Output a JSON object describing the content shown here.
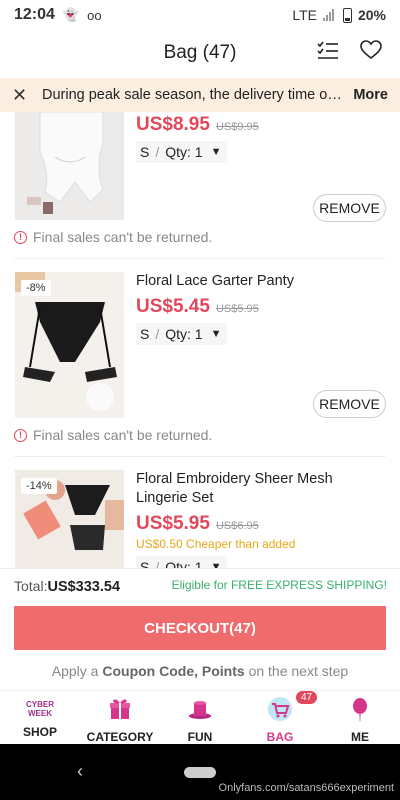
{
  "status": {
    "time": "12:04",
    "network": "LTE",
    "battery": "20%"
  },
  "header": {
    "title": "Bag (47)",
    "list_icon": "list-check-icon",
    "wish_icon": "heart-icon"
  },
  "notice": {
    "text": "During peak sale season, the delivery time of …",
    "more": "More"
  },
  "items": [
    {
      "name": "",
      "price": "US$8.95",
      "original_price": "US$9.95",
      "size": "S",
      "qty": "Qty: 1",
      "remove": "REMOVE",
      "final_sale": "Final sales can't be returned."
    },
    {
      "badge": "-8%",
      "name": "Floral Lace Garter Panty",
      "price": "US$5.45",
      "original_price": "US$5.95",
      "size": "S",
      "qty": "Qty: 1",
      "remove": "REMOVE",
      "final_sale": "Final sales can't be returned."
    },
    {
      "badge": "-14%",
      "name": "Floral Embroidery Sheer Mesh Lingerie Set",
      "price": "US$5.95",
      "original_price": "US$6.95",
      "cheaper_note": "US$0.50 Cheaper than added",
      "size": "S",
      "qty": "Qty: 1"
    }
  ],
  "summary": {
    "total_label": "Total:",
    "total_value": "US$333.54",
    "shipping_note": "Eligible for FREE EXPRESS SHIPPING!",
    "checkout": "CHECKOUT(47)",
    "coupon_pre": "Apply a ",
    "coupon_bold1": "Coupon Code, Points",
    "coupon_post": " on the next step"
  },
  "nav": [
    {
      "label": "SHOP",
      "icon": "cyber-week-icon",
      "icon_text": "CYBER WEEK"
    },
    {
      "label": "CATEGORY",
      "icon": "gift-icon"
    },
    {
      "label": "FUN",
      "icon": "hat-icon"
    },
    {
      "label": "BAG",
      "icon": "bag-icon",
      "count": "47",
      "active": true
    },
    {
      "label": "ME",
      "icon": "balloon-icon"
    }
  ],
  "watermark": "Onlyfans.com/satans666experiment",
  "colors": {
    "accent": "#e2485b",
    "checkout": "#f06b6b",
    "notice_bg": "#fbeee0",
    "green": "#3aaf6e",
    "active_tab": "#d63a8a"
  }
}
